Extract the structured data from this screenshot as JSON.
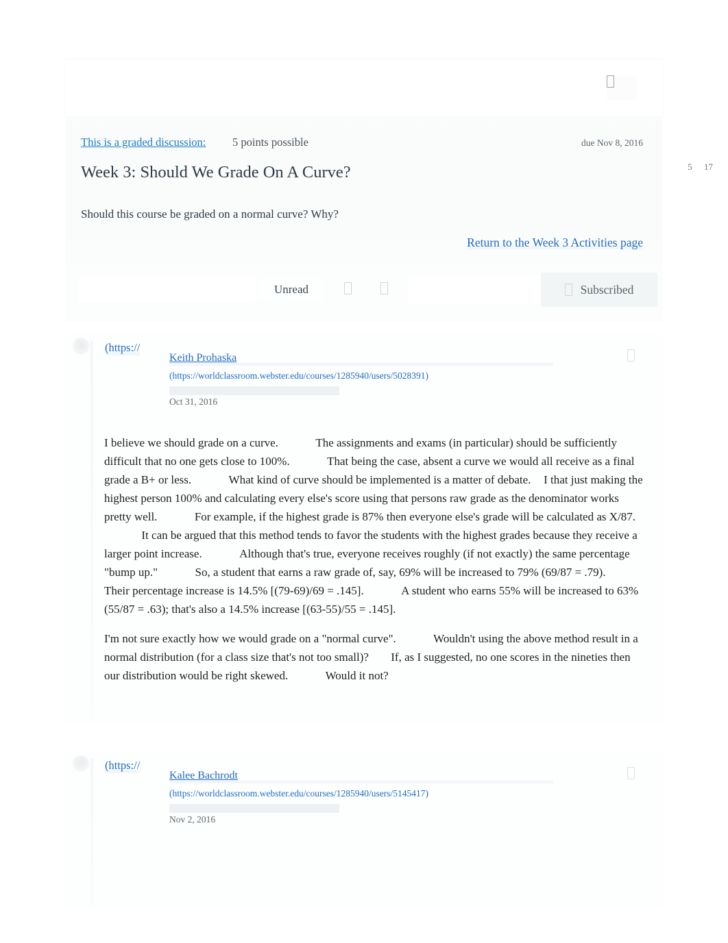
{
  "header": {
    "graded_label": "This is a graded discussion:",
    "points": "5 points possible",
    "due": "due Nov 8, 2016",
    "title": "Week 3: Should We Grade On A Curve?",
    "reply_count": "5",
    "view_count": "17",
    "menu_icon": "kebab-menu-icon"
  },
  "prompt": {
    "text": "Should this course be graded on a normal curve? Why?",
    "return_link": "Return to the Week 3 Activities page"
  },
  "toolbar": {
    "search_placeholder": "",
    "unread_label": "Unread",
    "icon_a": "collapse-icon",
    "icon_b": "expand-icon",
    "subscribed_label": "Subscribed",
    "subscribed_icon": "check-icon"
  },
  "entries": [
    {
      "https_fragment": "(https://",
      "author": "Keith Prohaska",
      "author_url": "(https://worldclassroom.webster.edu/courses/1285940/users/5028391)",
      "date": "Oct 31, 2016",
      "action_icon": "entry-menu-icon",
      "paragraphs": [
        {
          "runs": [
            {
              "t": "I believe we should grade on a curve."
            },
            {
              "gap": "wide"
            },
            {
              "t": "The assignments and exams (in particular) should be sufficiently difficult that no one gets close to 100%."
            },
            {
              "gap": "wide"
            },
            {
              "t": "That being the case, absent a curve we would all receive as a final grade a B+ or less."
            },
            {
              "gap": "wide"
            },
            {
              "t": "What kind of curve should be implemented is a matter of debate."
            },
            {
              "gap": "small"
            },
            {
              "t": "I that just making the highest person 100% and calculating every else's score using that persons raw grade as the denominator works pretty well."
            },
            {
              "gap": "wide"
            },
            {
              "t": "For example, if the highest grade is 87% then everyone else's grade will be calculated as X/87."
            },
            {
              "gap": "wide"
            },
            {
              "t": "It can be argued that this method tends to favor the students with the highest grades because they receive a larger point increase."
            },
            {
              "gap": "wide"
            },
            {
              "t": "Although that's true, everyone receives roughly (if not exactly) the same percentage \"bump up.\""
            },
            {
              "gap": "wide"
            },
            {
              "t": "So, a student that earns a raw grade of, say, 69% will be increased to 79% (69/87 = .79)."
            },
            {
              "gap": "wide"
            },
            {
              "t": "Their percentage increase is 14.5% [(79-69)/69 = .145]."
            },
            {
              "gap": "wide"
            },
            {
              "t": "A student who earns 55% will be increased to 63% (55/87 = .63); that's also a 14.5% increase [(63-55)/55 = .145]."
            }
          ]
        },
        {
          "runs": [
            {
              "t": "I'm not sure exactly how we would grade on a \"normal curve\"."
            },
            {
              "gap": "wide"
            },
            {
              "t": "Wouldn't using the above method result in a normal distribution (for a class size that's not too small)?"
            },
            {
              "gap": "medium"
            },
            {
              "t": "If, as I suggested, no one scores in the nineties then our distribution would be right skewed."
            },
            {
              "gap": "wide"
            },
            {
              "t": "Would it not?"
            }
          ]
        }
      ]
    },
    {
      "https_fragment": "(https://",
      "author": "Kalee Bachrodt",
      "author_url": "(https://worldclassroom.webster.edu/courses/1285940/users/5145417)",
      "date": "Nov 2, 2016",
      "action_icon": "entry-menu-icon",
      "paragraphs": []
    }
  ],
  "colors": {
    "link": "#1f6bc4",
    "graded_link": "#1a7dc4",
    "text": "#2d3b45",
    "muted": "#5c676d",
    "panel": "#fbfcfc"
  }
}
